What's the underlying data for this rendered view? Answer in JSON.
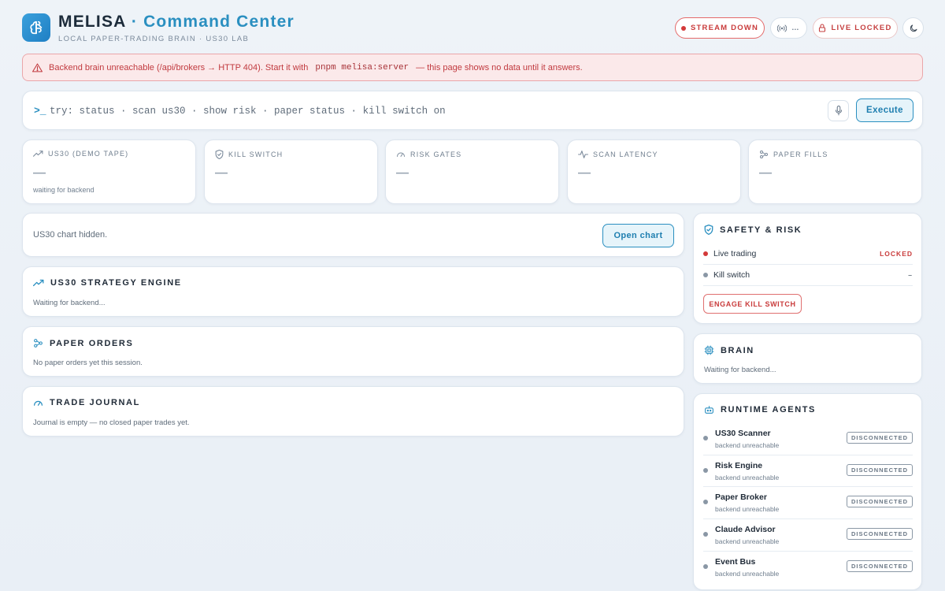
{
  "header": {
    "brand": "MELISA",
    "separator": "·",
    "title": "Command Center",
    "subtitle": "LOCAL PAPER-TRADING BRAIN · US30 LAB",
    "stream_status": "STREAM DOWN",
    "connection_label": "…",
    "live_status": "LIVE LOCKED"
  },
  "alert": {
    "prefix": "Backend brain unreachable (/api/brokers → HTTP 404). Start it with",
    "command": "pnpm melisa:server",
    "suffix": "— this page shows no data until it answers."
  },
  "command_bar": {
    "prompt": ">_",
    "placeholder": "try: status · scan us30 · show risk · paper status · kill switch on",
    "execute_label": "Execute"
  },
  "stats": [
    {
      "label": "US30 (DEMO TAPE)",
      "value": "—",
      "note": "waiting for backend",
      "icon": "trend-up-icon"
    },
    {
      "label": "KILL SWITCH",
      "value": "—",
      "note": "",
      "icon": "shield-icon"
    },
    {
      "label": "RISK GATES",
      "value": "—",
      "note": "",
      "icon": "gauge-icon"
    },
    {
      "label": "SCAN LATENCY",
      "value": "—",
      "note": "",
      "icon": "pulse-icon"
    },
    {
      "label": "PAPER FILLS",
      "value": "—",
      "note": "",
      "icon": "network-icon"
    }
  ],
  "chart_panel": {
    "text": "US30 chart hidden.",
    "button": "Open chart"
  },
  "strategy": {
    "title": "US30 STRATEGY ENGINE",
    "text": "Waiting for backend..."
  },
  "paper_orders": {
    "title": "PAPER ORDERS",
    "text": "No paper orders yet this session."
  },
  "journal": {
    "title": "TRADE JOURNAL",
    "text": "Journal is empty — no closed paper trades yet."
  },
  "safety": {
    "title": "SAFETY & RISK",
    "rows": [
      {
        "label": "Live trading",
        "value": "LOCKED"
      },
      {
        "label": "Kill switch",
        "value": "–"
      }
    ],
    "button": "ENGAGE KILL SWITCH"
  },
  "brain": {
    "title": "BRAIN",
    "text": "Waiting for backend..."
  },
  "agents": {
    "title": "RUNTIME AGENTS",
    "items": [
      {
        "name": "US30 Scanner",
        "sub": "backend unreachable",
        "status": "DISCONNECTED"
      },
      {
        "name": "Risk Engine",
        "sub": "backend unreachable",
        "status": "DISCONNECTED"
      },
      {
        "name": "Paper Broker",
        "sub": "backend unreachable",
        "status": "DISCONNECTED"
      },
      {
        "name": "Claude Advisor",
        "sub": "backend unreachable",
        "status": "DISCONNECTED"
      },
      {
        "name": "Event Bus",
        "sub": "backend unreachable",
        "status": "DISCONNECTED"
      }
    ]
  },
  "colors": {
    "accent": "#2a8fc0",
    "danger": "#c93b3b",
    "muted": "#8a97a5"
  }
}
